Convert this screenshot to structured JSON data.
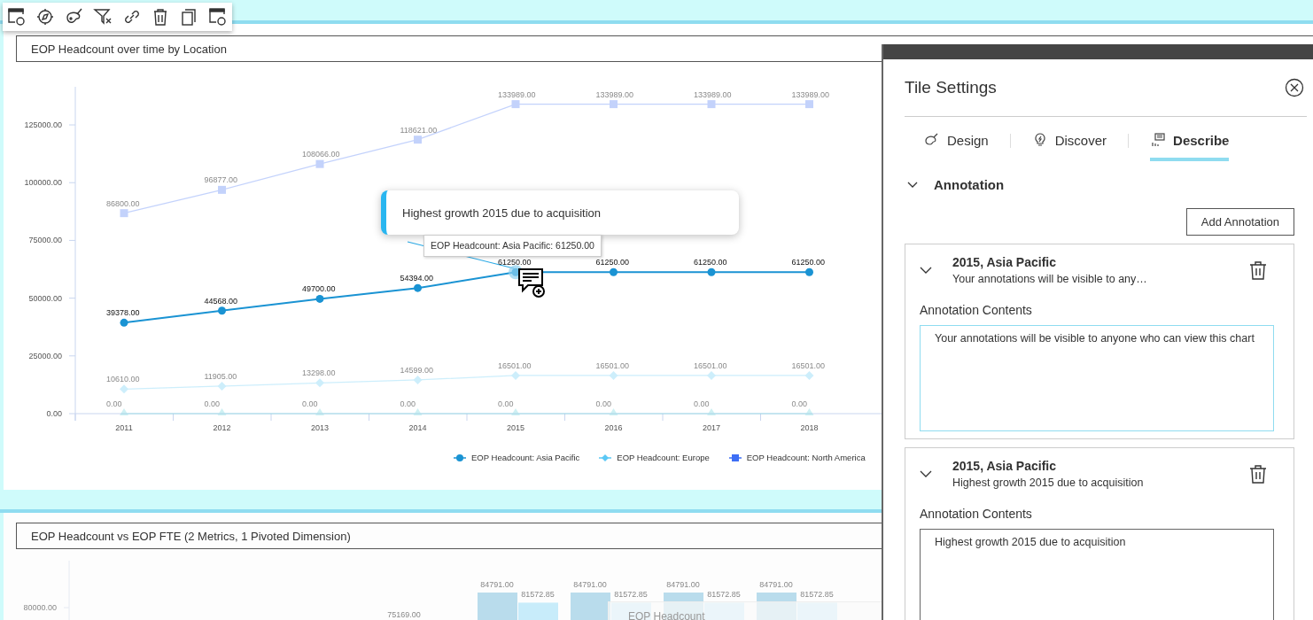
{
  "tile1": {
    "title": "EOP Headcount over time by Location",
    "chart_data": {
      "type": "line",
      "categories": [
        "2011",
        "2012",
        "2013",
        "2014",
        "2015",
        "2016",
        "2017",
        "2018"
      ],
      "ylim": [
        0,
        141500
      ],
      "yticks": [
        {
          "value": 0,
          "label": "0.00"
        },
        {
          "value": 25000,
          "label": "25000.00"
        },
        {
          "value": 50000,
          "label": "50000.00"
        },
        {
          "value": 75000,
          "label": "75000.00"
        },
        {
          "value": 100000,
          "label": "100000.00"
        },
        {
          "value": 125000,
          "label": "125000.00"
        }
      ],
      "series": [
        {
          "name": "EOP Headcount: Asia Pacific",
          "color": "#1a93d3",
          "marker": "circle",
          "values": [
            39378,
            44568,
            49700,
            54394,
            61250,
            61250,
            61250,
            61250
          ],
          "value_labels": [
            "39378.00",
            "44568.00",
            "49700.00",
            "54394.00",
            "61250.00",
            "61250.00",
            "61250.00",
            "61250.00"
          ]
        },
        {
          "name": "EOP Headcount: Europe",
          "color": "#5bc8f5",
          "marker": "diamond",
          "values": [
            10610,
            11905,
            13298,
            14599,
            16501,
            16501,
            16501,
            16501
          ],
          "value_labels": [
            "10610.00",
            "11905.00",
            "13298.00",
            "14599.00",
            "16501.00",
            "16501.00",
            "16501.00",
            "16501.00"
          ]
        },
        {
          "name": "EOP Headcount: North America",
          "color": "#3d6ef5",
          "marker": "square",
          "values": [
            86800,
            96877,
            108066,
            118621,
            133989,
            133989,
            133989,
            133989
          ],
          "value_labels": [
            "86800.00",
            "96877.00",
            "108066.00",
            "118621.00",
            "133989.00",
            "133989.00",
            "133989.00",
            "133989.00"
          ]
        },
        {
          "color": "#5fd0d8",
          "marker": "triangle",
          "values": [
            0,
            0,
            0,
            0,
            0,
            0,
            0,
            0
          ],
          "value_labels": [
            "0.00",
            "0.00",
            "0.00",
            "0.00",
            "0.00",
            "0.00",
            "0.00",
            "0.00"
          ]
        }
      ]
    },
    "annotation_popup": "Highest growth 2015 due to acquisition",
    "hover_tooltip": "EOP Headcount: Asia Pacific: 61250.00"
  },
  "tile2": {
    "title": "EOP Headcount vs EOP FTE (2 Metrics, 1 Pivoted Dimension)",
    "y_label": "80000.00",
    "bar_groups": [
      {
        "labels": [
          "75169.00"
        ]
      },
      {
        "labels": [
          "84791.00",
          "81572.85"
        ]
      },
      {
        "labels": [
          "84791.00",
          "81572.85"
        ]
      },
      {
        "labels": [
          "84791.00",
          "81572.85"
        ]
      },
      {
        "labels": [
          "84791.00",
          "81572.85"
        ]
      }
    ],
    "tooltip_title": "EOP Headcount"
  },
  "panel": {
    "title": "Tile Settings",
    "tabs": [
      {
        "label": "Design",
        "selected": false
      },
      {
        "label": "Discover",
        "selected": false
      },
      {
        "label": "Describe",
        "selected": true
      }
    ],
    "section": {
      "title": "Annotation",
      "expanded": true
    },
    "add_button": "Add Annotation",
    "annotations": [
      {
        "title": "2015, Asia Pacific",
        "summary": "Your annotations will be visible to any…",
        "expanded": true,
        "contents_label": "Annotation Contents",
        "contents": "Your annotations will be visible to anyone who can view this chart",
        "focused": true
      },
      {
        "title": "2015, Asia Pacific",
        "summary": "Highest growth 2015 due to acquisition",
        "expanded": true,
        "contents_label": "Annotation Contents",
        "contents": "Highest growth 2015 due to acquisition",
        "focused": false
      }
    ]
  }
}
